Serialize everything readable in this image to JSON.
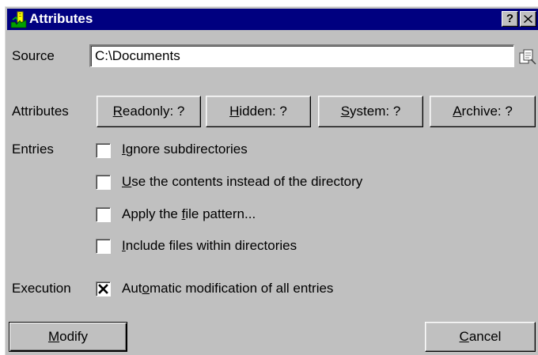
{
  "window": {
    "title": "Attributes",
    "help_button": "?",
    "close_icon": "close-icon"
  },
  "source": {
    "label": "Source",
    "value": "C:\\Documents"
  },
  "attributes": {
    "label": "Attributes",
    "buttons": [
      {
        "mnemonic": "R",
        "rest": "eadonly: ?"
      },
      {
        "mnemonic": "H",
        "rest": "idden: ?"
      },
      {
        "mnemonic": "S",
        "rest": "ystem: ?"
      },
      {
        "mnemonic": "A",
        "rest": "rchive: ?"
      }
    ]
  },
  "entries": {
    "label": "Entries",
    "options": [
      {
        "pre": "",
        "mnemonic": "I",
        "post": "gnore subdirectories",
        "checked": false
      },
      {
        "pre": "",
        "mnemonic": "U",
        "post": "se the contents instead of the directory",
        "checked": false
      },
      {
        "pre": "Apply the ",
        "mnemonic": "f",
        "post": "ile pattern...",
        "checked": false
      },
      {
        "pre": "",
        "mnemonic": "I",
        "post": "nclude files within directories",
        "checked": false
      }
    ]
  },
  "execution": {
    "label": "Execution",
    "option": {
      "pre": "Aut",
      "mnemonic": "o",
      "post": "matic modification of all entries",
      "checked": true
    }
  },
  "footer": {
    "modify": {
      "mnemonic": "M",
      "rest": "odify"
    },
    "cancel": {
      "mnemonic": "C",
      "rest": "ancel"
    }
  },
  "colors": {
    "face": "#c0c0c0",
    "title_bar": "#000080",
    "title_text": "#ffffff"
  }
}
